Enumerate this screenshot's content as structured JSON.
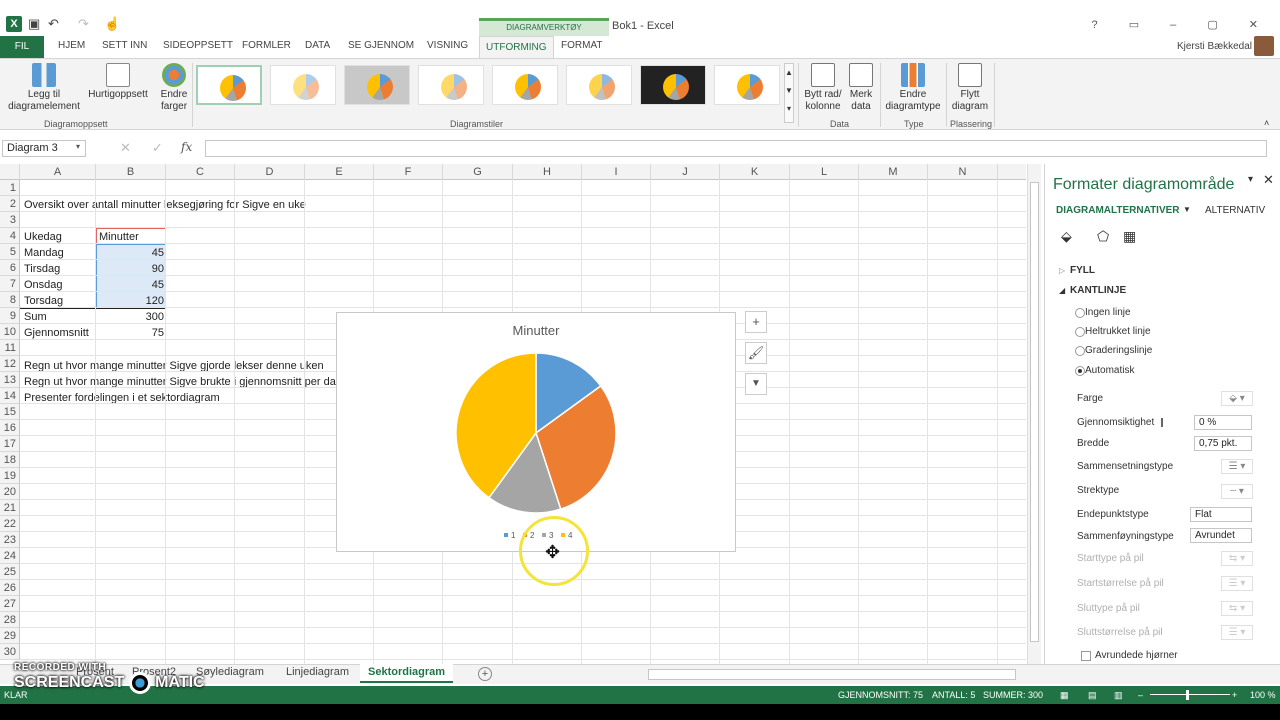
{
  "titlebar": {
    "context_label": "DIAGRAMVERKTØY",
    "doc_title": "Bok1 - Excel",
    "user": "Kjersti Bækkedal"
  },
  "tabs": [
    "FIL",
    "HJEM",
    "SETT INN",
    "SIDEOPPSETT",
    "FORMLER",
    "DATA",
    "SE GJENNOM",
    "VISNING",
    "UTFORMING",
    "FORMAT"
  ],
  "active_tab": "UTFORMING",
  "ribbon": {
    "add_element": [
      "Legg til",
      "diagramelement"
    ],
    "quick_layout": "Hurtigoppsett",
    "change_colors": [
      "Endre",
      "farger"
    ],
    "group_layout": "Diagramoppsett",
    "group_styles": "Diagramstiler",
    "switch_rowcol": [
      "Bytt rad/",
      "kolonne"
    ],
    "select_data": [
      "Merk",
      "data"
    ],
    "group_data": "Data",
    "change_type": [
      "Endre",
      "diagramtype"
    ],
    "group_type": "Type",
    "move_chart": [
      "Flytt",
      "diagram"
    ],
    "group_location": "Plassering"
  },
  "formula_bar": {
    "name_box": "Diagram 3",
    "fx": "fx",
    "content": ""
  },
  "columns": [
    "A",
    "B",
    "C",
    "D",
    "E",
    "F",
    "G",
    "H",
    "I",
    "J",
    "K",
    "L",
    "M",
    "N"
  ],
  "rows": [
    "1",
    "2",
    "3",
    "4",
    "5",
    "6",
    "7",
    "8",
    "9",
    "10",
    "11",
    "12",
    "13",
    "14",
    "15",
    "16",
    "17",
    "18",
    "19",
    "20",
    "21",
    "22",
    "23",
    "24",
    "25",
    "26",
    "27",
    "28",
    "29",
    "30"
  ],
  "sheet": {
    "r2": "Oversikt over antall minutter leksegjøring for Sigve en uke",
    "header_day": "Ukedag",
    "header_min": "Minutter",
    "days": [
      "Mandag",
      "Tirsdag",
      "Onsdag",
      "Torsdag"
    ],
    "minutes": [
      "45",
      "90",
      "45",
      "120"
    ],
    "sum_label": "Sum",
    "sum_value": "300",
    "avg_label": "Gjennomsnitt",
    "avg_value": "75",
    "r12": "Regn ut hvor mange minutter Sigve gjorde lekser denne uken",
    "r13": "Regn ut hvor mange minutter Sigve brukte i gjennomsnitt per dag",
    "r14": "Presenter fordelingen i et sektordiagram"
  },
  "chart_data": {
    "type": "pie",
    "title": "Minutter",
    "categories": [
      "1",
      "2",
      "3",
      "4"
    ],
    "values": [
      45,
      90,
      45,
      120
    ],
    "colors": [
      "#5b9bd5",
      "#ed7d31",
      "#a5a5a5",
      "#ffc000"
    ],
    "legend": "bottom"
  },
  "pane": {
    "title": "Formater diagramområde",
    "tab_options": "DIAGRAMALTERNATIVER",
    "tab_alt": "ALTERNATIV",
    "fill": "FYLL",
    "border": "KANTLINJE",
    "radios": [
      "Ingen linje",
      "Heltrukket linje",
      "Graderingslinje",
      "Automatisk"
    ],
    "color_label": "Farge",
    "transparency_label": "Gjennomsiktighet",
    "transparency_value": "0 %",
    "width_label": "Bredde",
    "width_value": "0,75 pkt.",
    "compound_label": "Sammensetningstype",
    "dash_label": "Strektype",
    "cap_label": "Endepunktstype",
    "cap_value": "Flat",
    "join_label": "Sammenføyningstype",
    "join_value": "Avrundet",
    "begin_arrow_type": "Starttype på pil",
    "begin_arrow_size": "Startstørrelse på pil",
    "end_arrow_type": "Sluttype på pil",
    "end_arrow_size": "Sluttstørrelse på pil",
    "rounded_corners": "Avrundede hjørner"
  },
  "sheet_tabs": [
    "Prosent",
    "Prosent2",
    "Søylediagram",
    "Linjediagram",
    "Sektordiagram"
  ],
  "active_sheet": "Sektordiagram",
  "status": {
    "mode": "KLAR",
    "average": "GJENNOMSNITT: 75",
    "count": "ANTALL: 5",
    "sum": "SUMMER: 300",
    "zoom": "100 %"
  },
  "watermark": {
    "line1": "RECORDED WITH",
    "line2": "SCREENCAST",
    "line3": "MATIC"
  }
}
